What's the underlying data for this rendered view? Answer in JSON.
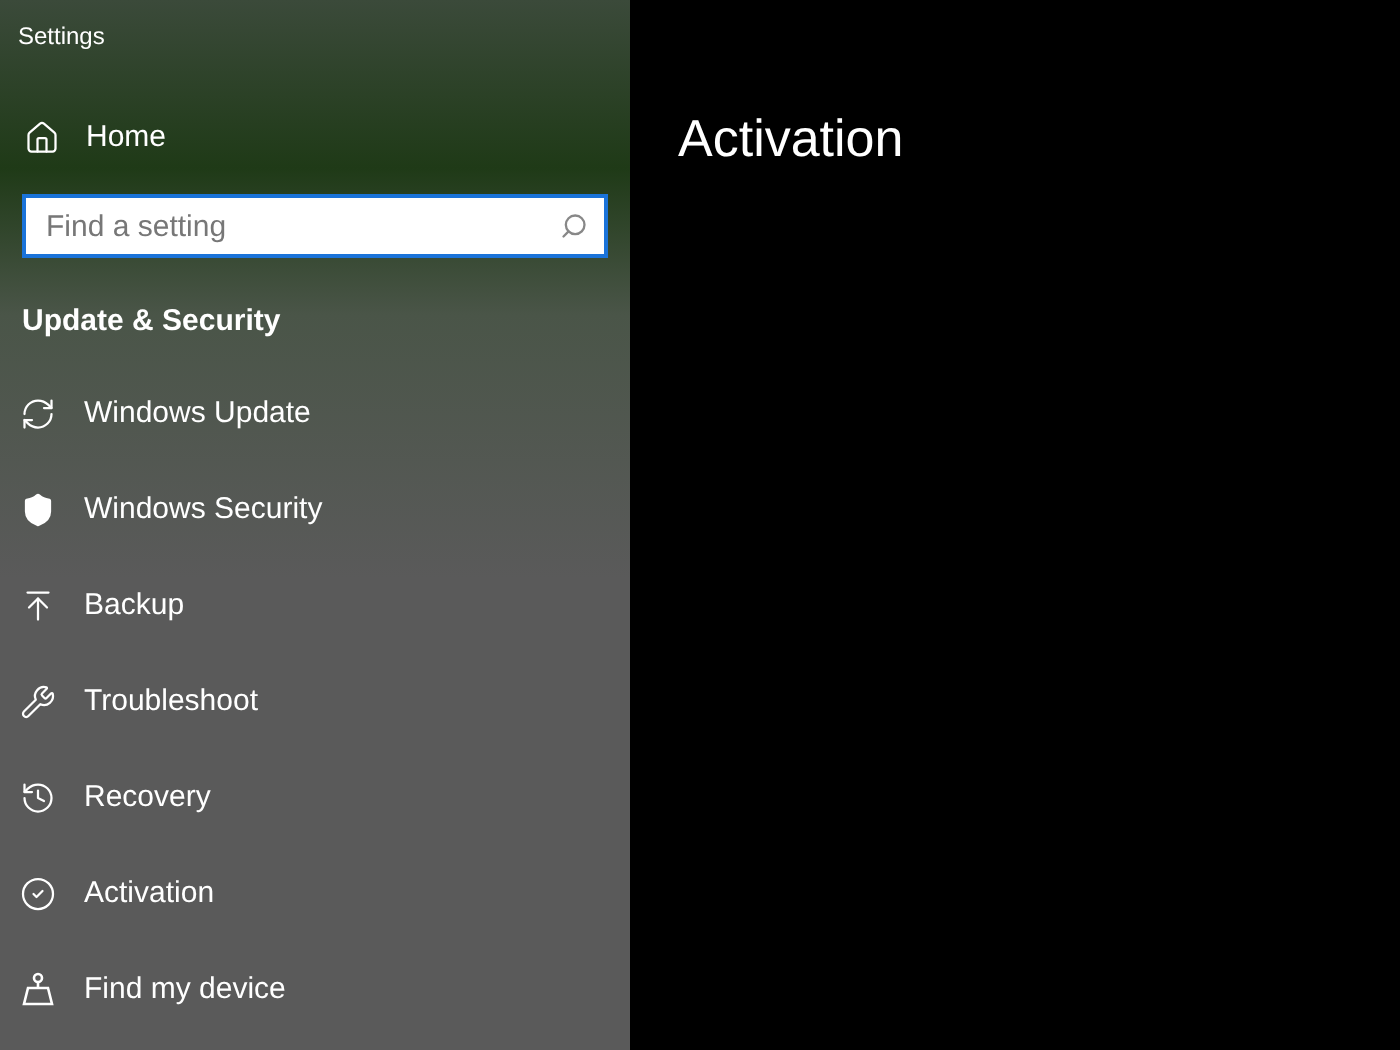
{
  "window": {
    "title": "Settings"
  },
  "sidebar": {
    "home": "Home",
    "search": {
      "placeholder": "Find a setting"
    },
    "section_title": "Update & Security",
    "items": [
      {
        "label": "Windows Update"
      },
      {
        "label": "Windows Security"
      },
      {
        "label": "Backup"
      },
      {
        "label": "Troubleshoot"
      },
      {
        "label": "Recovery"
      },
      {
        "label": "Activation"
      },
      {
        "label": "Find my device"
      }
    ]
  },
  "page": {
    "title": "Activation"
  }
}
